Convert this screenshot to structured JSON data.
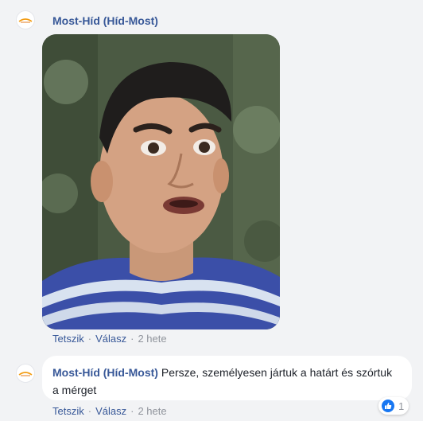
{
  "comments": [
    {
      "author": "Most-Híd (Híd-Most)",
      "actions": {
        "like": "Tetszik",
        "reply": "Válasz",
        "time": "2 hete"
      }
    },
    {
      "author": "Most-Híd (Híd-Most)",
      "text": "Persze, személyesen jártuk a határt és szórtuk a mérget",
      "actions": {
        "like": "Tetszik",
        "reply": "Válasz",
        "time": "2 hete"
      },
      "reactions": {
        "icon": "thumbs-up-icon",
        "count": "1"
      }
    }
  ],
  "separator": "·",
  "colors": {
    "link": "#385898",
    "meta": "#90949c",
    "like": "#1877f2",
    "background": "#f2f3f5"
  }
}
